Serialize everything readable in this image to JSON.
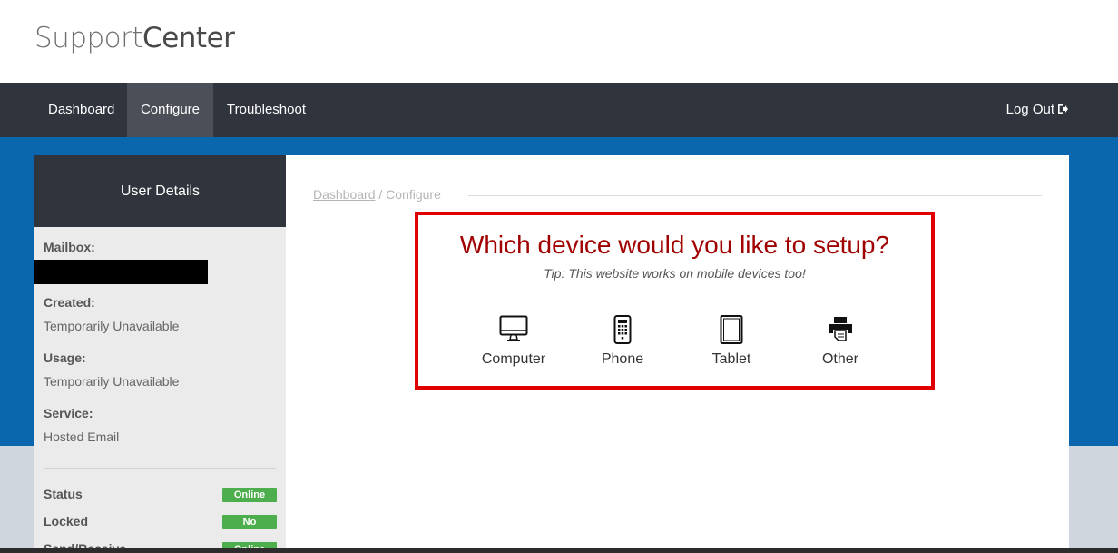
{
  "header": {
    "logo_light": "Support",
    "logo_bold": "Center"
  },
  "nav": {
    "items": [
      {
        "label": "Dashboard",
        "active": false
      },
      {
        "label": "Configure",
        "active": true
      },
      {
        "label": "Troubleshoot",
        "active": false
      }
    ],
    "logout_label": "Log Out"
  },
  "sidebar": {
    "title": "User Details",
    "mailbox_label": "Mailbox:",
    "created_label": "Created:",
    "created_value": "Temporarily Unavailable",
    "usage_label": "Usage:",
    "usage_value": "Temporarily Unavailable",
    "service_label": "Service:",
    "service_value": "Hosted Email",
    "status_label": "Status",
    "status_value": "Online",
    "locked_label": "Locked",
    "locked_value": "No",
    "sendreceive_label": "Send/Receive",
    "sendreceive_value": "Online",
    "badge_color": "#4cae4c"
  },
  "breadcrumb": {
    "link": "Dashboard",
    "separator": " / ",
    "current": "Configure"
  },
  "device_setup": {
    "title": "Which device would you like to setup?",
    "tip": "Tip: This website works on mobile devices too!",
    "options": [
      {
        "label": "Computer",
        "icon": "computer-icon"
      },
      {
        "label": "Phone",
        "icon": "phone-icon"
      },
      {
        "label": "Tablet",
        "icon": "tablet-icon"
      },
      {
        "label": "Other",
        "icon": "printer-icon"
      }
    ],
    "border_color": "#e00000",
    "title_color": "#a00000"
  },
  "colors": {
    "navbar": "#30343d",
    "blueband": "#0a66ad",
    "background": "#d0d6dd"
  }
}
